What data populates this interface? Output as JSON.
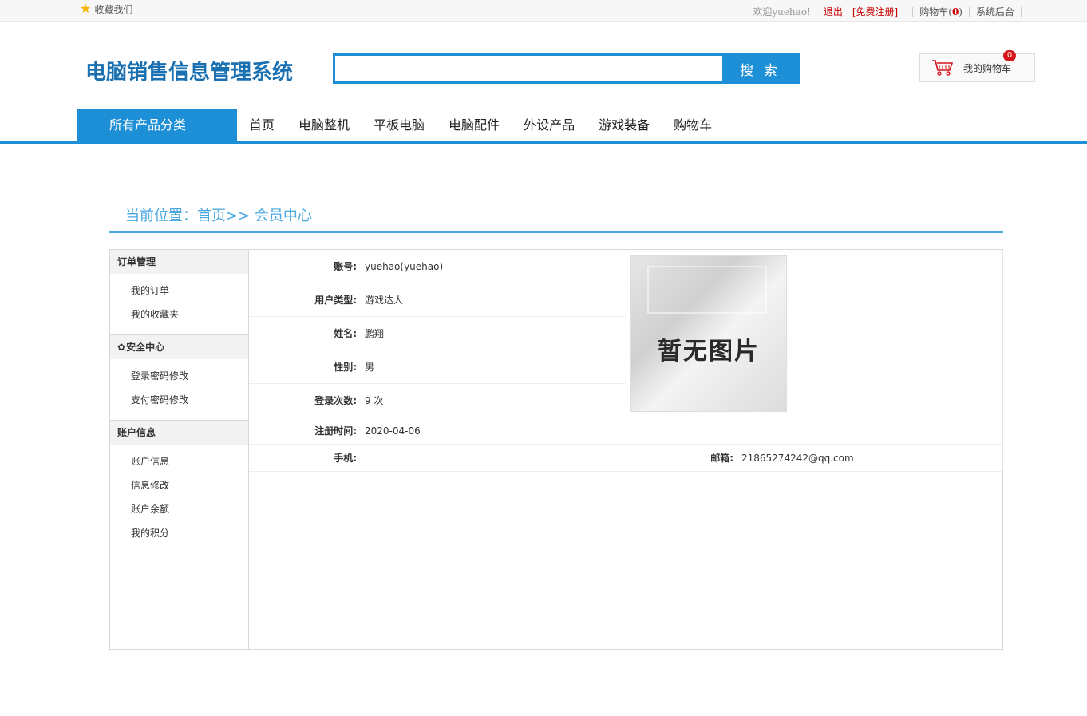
{
  "topbar": {
    "favorite": "收藏我们",
    "welcome": "欢迎yuehao!",
    "logout": "退出",
    "register": "[免费注册]",
    "cart_prefix": "购物车(",
    "cart_count": "0",
    "cart_suffix": ")",
    "admin": "系统后台"
  },
  "header": {
    "logo": "电脑销售信息管理系统",
    "search_placeholder": "",
    "search_button": "搜 索",
    "my_cart_label": "我的购物车",
    "my_cart_badge": "0"
  },
  "nav": {
    "all_categories": "所有产品分类",
    "items": [
      "首页",
      "电脑整机",
      "平板电脑",
      "电脑配件",
      "外设产品",
      "游戏装备",
      "购物车"
    ]
  },
  "breadcrumb": "当前位置：首页>> 会员中心",
  "sidebar": {
    "groups": [
      {
        "title": "订单管理",
        "items": [
          "我的订单",
          "我的收藏夹"
        ]
      },
      {
        "title": "安全中心",
        "items": [
          "登录密码修改",
          "支付密码修改"
        ]
      },
      {
        "title": "账户信息",
        "items": [
          "账户信息",
          "信息修改",
          "账户余额",
          "我的积分"
        ]
      }
    ]
  },
  "profile": {
    "account_label": "账号:",
    "account_value": "yuehao(yuehao)",
    "user_type_label": "用户类型:",
    "user_type_value": "游戏达人",
    "name_label": "姓名:",
    "name_value": "鹏翔",
    "gender_label": "性别:",
    "gender_value": "男",
    "login_count_label": "登录次数:",
    "login_count_value": "9 次",
    "register_time_label": "注册时间:",
    "register_time_value": "2020-04-06",
    "phone_label": "手机:",
    "phone_value": "",
    "email_label": "邮箱:",
    "email_value": "21865274242@qq.com",
    "photo_text": "暂无图片"
  }
}
